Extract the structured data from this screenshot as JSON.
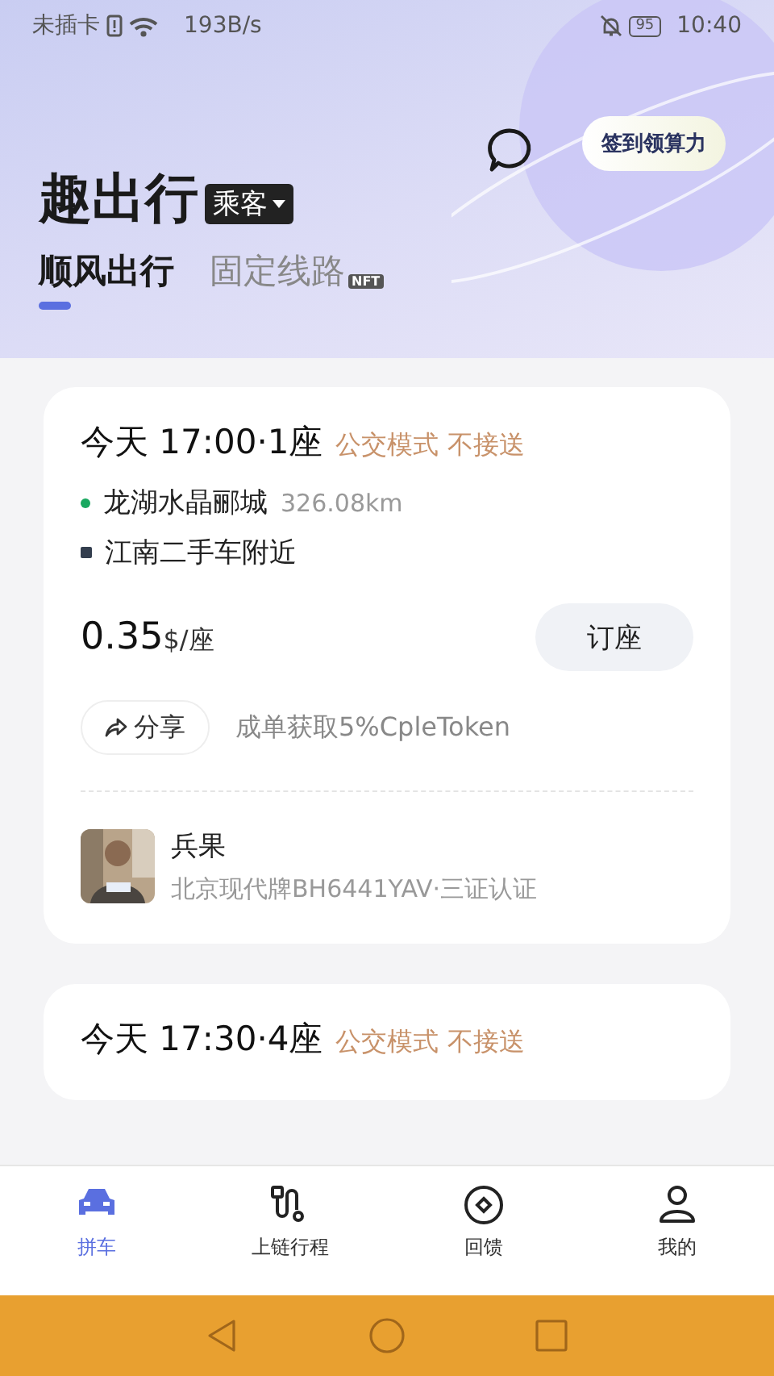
{
  "status_bar": {
    "carrier": "未插卡",
    "speed": "193B/s",
    "battery": "95",
    "time": "10:40"
  },
  "header": {
    "title": "趣出行",
    "role": "乘客",
    "checkin_button": "签到领算力"
  },
  "tabs": [
    {
      "label": "顺风出行",
      "selected": true
    },
    {
      "label": "固定线路",
      "selected": false,
      "badge": "NFT"
    }
  ],
  "trips": [
    {
      "time": "今天 17:00·1座",
      "mode": "公交模式 不接送",
      "from": {
        "name": "龙湖水晶郦城",
        "distance": "326.08km"
      },
      "to": {
        "name": "江南二手车附近"
      },
      "price": "0.35",
      "unit": "$/座",
      "book_button": "订座",
      "share_button": "分享",
      "reward": "成单获取5%CpleToken",
      "driver": {
        "name": "兵果",
        "info": "北京现代牌BH6441YAV·三证认证"
      }
    },
    {
      "time": "今天 17:30·4座",
      "mode": "公交模式 不接送"
    }
  ],
  "bottom_nav": [
    {
      "label": "拼车",
      "selected": true
    },
    {
      "label": "上链行程",
      "selected": false
    },
    {
      "label": "回馈",
      "selected": false
    },
    {
      "label": "我的",
      "selected": false
    }
  ]
}
